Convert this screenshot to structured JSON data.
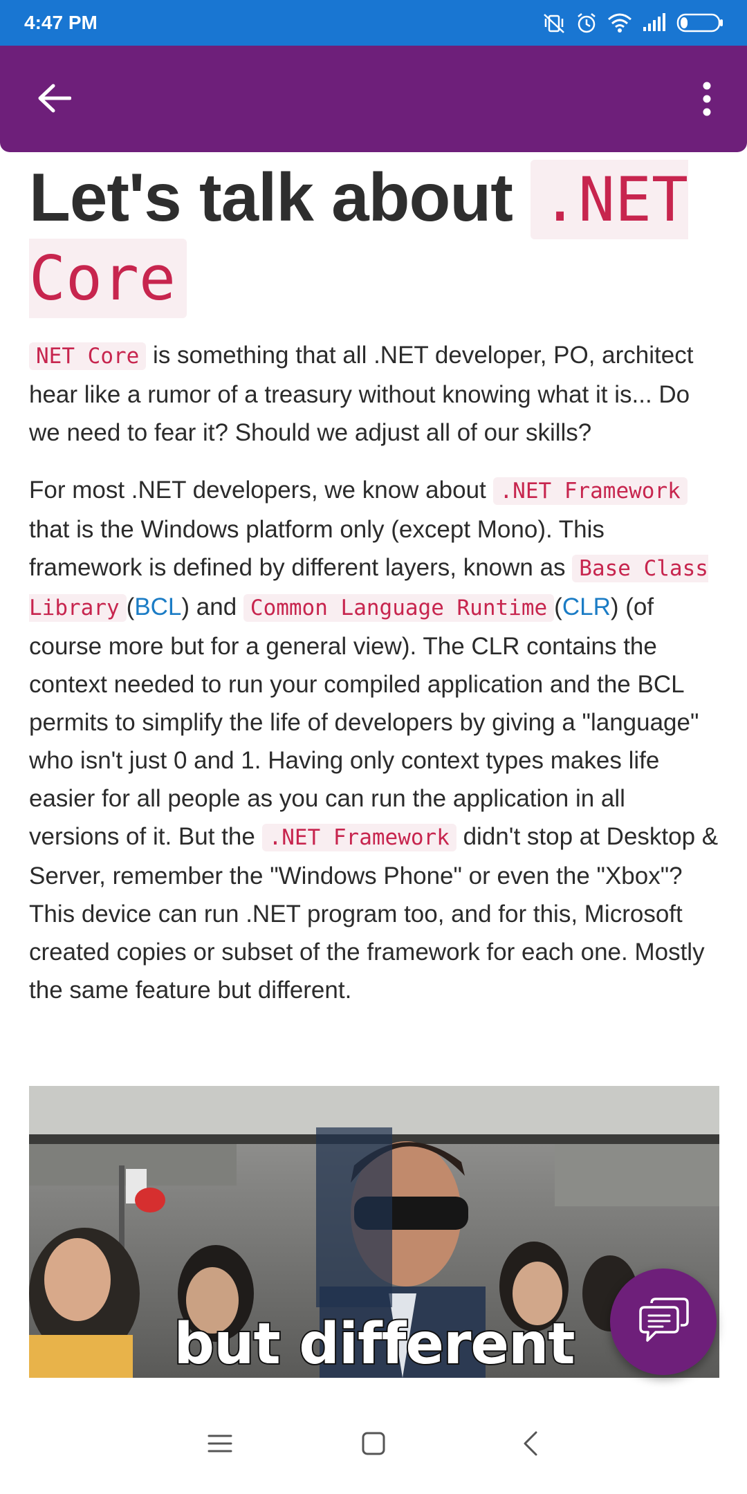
{
  "status_bar": {
    "time": "4:47 PM",
    "icons": [
      "vibrate-off-icon",
      "alarm-icon",
      "wifi-icon",
      "signal-icon",
      "battery-icon"
    ]
  },
  "app_bar": {
    "back_icon": "arrow-left-icon",
    "menu_icon": "more-vertical-icon",
    "color": "#6e1f7a"
  },
  "article": {
    "title_text": "Let's talk about ",
    "title_code": ".NET Core",
    "p1": {
      "code": "NET Core",
      "text": " is something that all .NET developer, PO, architect hear like a rumor of a treasury without knowing what it is... Do we need to fear it? Should we adjust all of our skills?"
    },
    "p2": {
      "t1": "For most .NET developers, we know about ",
      "c1": ".NET Framework",
      "t2": " that is the Windows platform only (except Mono). This framework is defined by different layers, known as ",
      "c2": "Base Class Library",
      "t3": "(",
      "l1": "BCL",
      "t4": ") and ",
      "c3": "Common Language Runtime",
      "t5": "(",
      "l2": "CLR",
      "t6": ") (of course more but for a general view). The CLR contains the context needed to run your compiled application and the BCL permits to simplify the life of developers by giving a \"language\" who isn't just 0 and 1. Having only context types makes life easier for all people as you can run the application in all versions of it. But the ",
      "c4": ".NET Framework",
      "t7": " didn't stop at Desktop & Server, remember the \"Windows Phone\" or even the \"Xbox\"? This device can run .NET program too, and for this, Microsoft created copies or subset of the framework for each one. Mostly the same feature but different."
    },
    "image_caption": "but different"
  },
  "fab": {
    "icon": "chat-bubbles-icon"
  },
  "nav_bar": {
    "icons": [
      "menu-lines-icon",
      "home-square-icon",
      "back-chevron-icon"
    ]
  }
}
